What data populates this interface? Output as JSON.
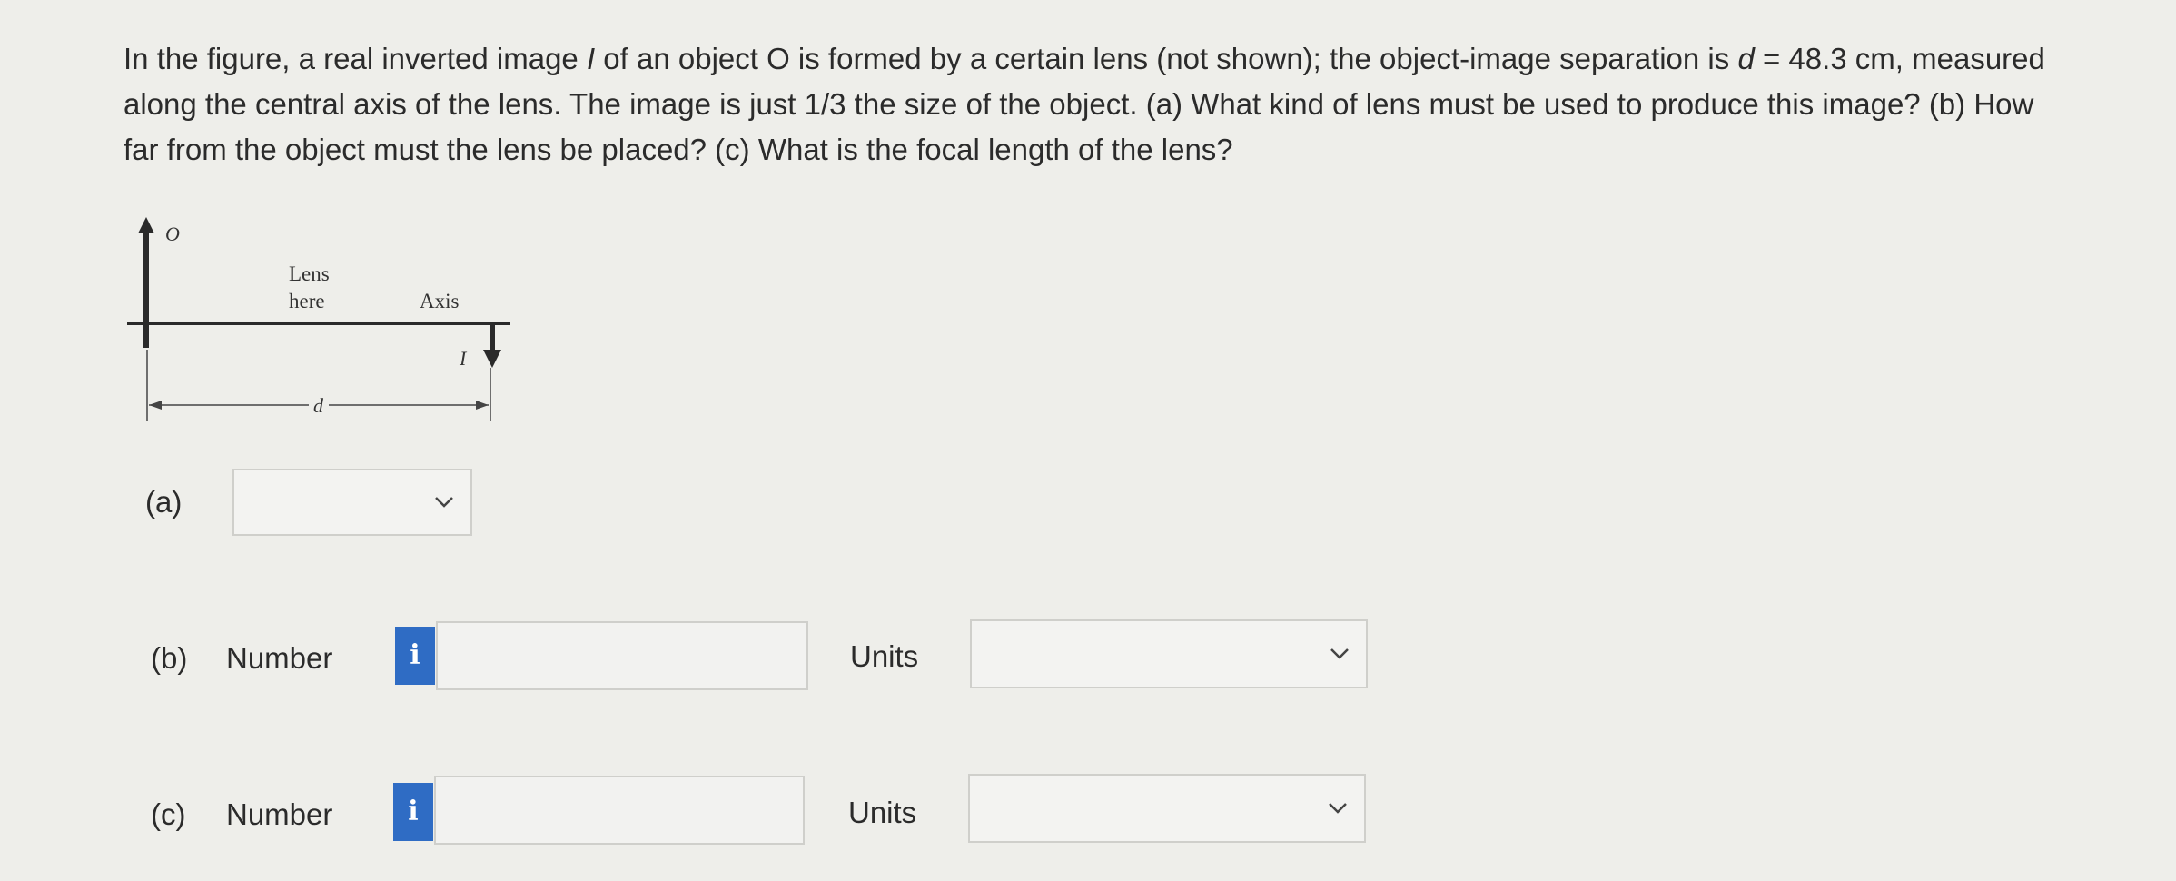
{
  "question": {
    "seg1": "In the figure, a real inverted image ",
    "image_symbol": "I",
    "seg2": " of an object O is formed by a certain lens (not shown); the object-image separation is ",
    "d_symbol": "d",
    "seg3": " = 48.3 cm, measured along the central axis of the lens. The image is just 1/3 the size of the object. (a) What kind of lens must be used to produce this image? (b) How far from the object must the lens be placed? (c) What is the focal length of the lens?"
  },
  "figure": {
    "object_label": "O",
    "lens_label_line1": "Lens",
    "lens_label_line2": "here",
    "axis_label": "Axis",
    "image_label": "I",
    "distance_label": "d"
  },
  "part_a": {
    "label": "(a)",
    "selected": ""
  },
  "part_b": {
    "label": "(b)",
    "number_label": "Number",
    "info_icon": "i",
    "value": "",
    "units_label": "Units",
    "units_selected": ""
  },
  "part_c": {
    "label": "(c)",
    "number_label": "Number",
    "info_icon": "i",
    "value": "",
    "units_label": "Units",
    "units_selected": ""
  },
  "colors": {
    "background": "#eeeeea",
    "info_button": "#2f6cc4",
    "field_border": "#cfcfcb"
  }
}
